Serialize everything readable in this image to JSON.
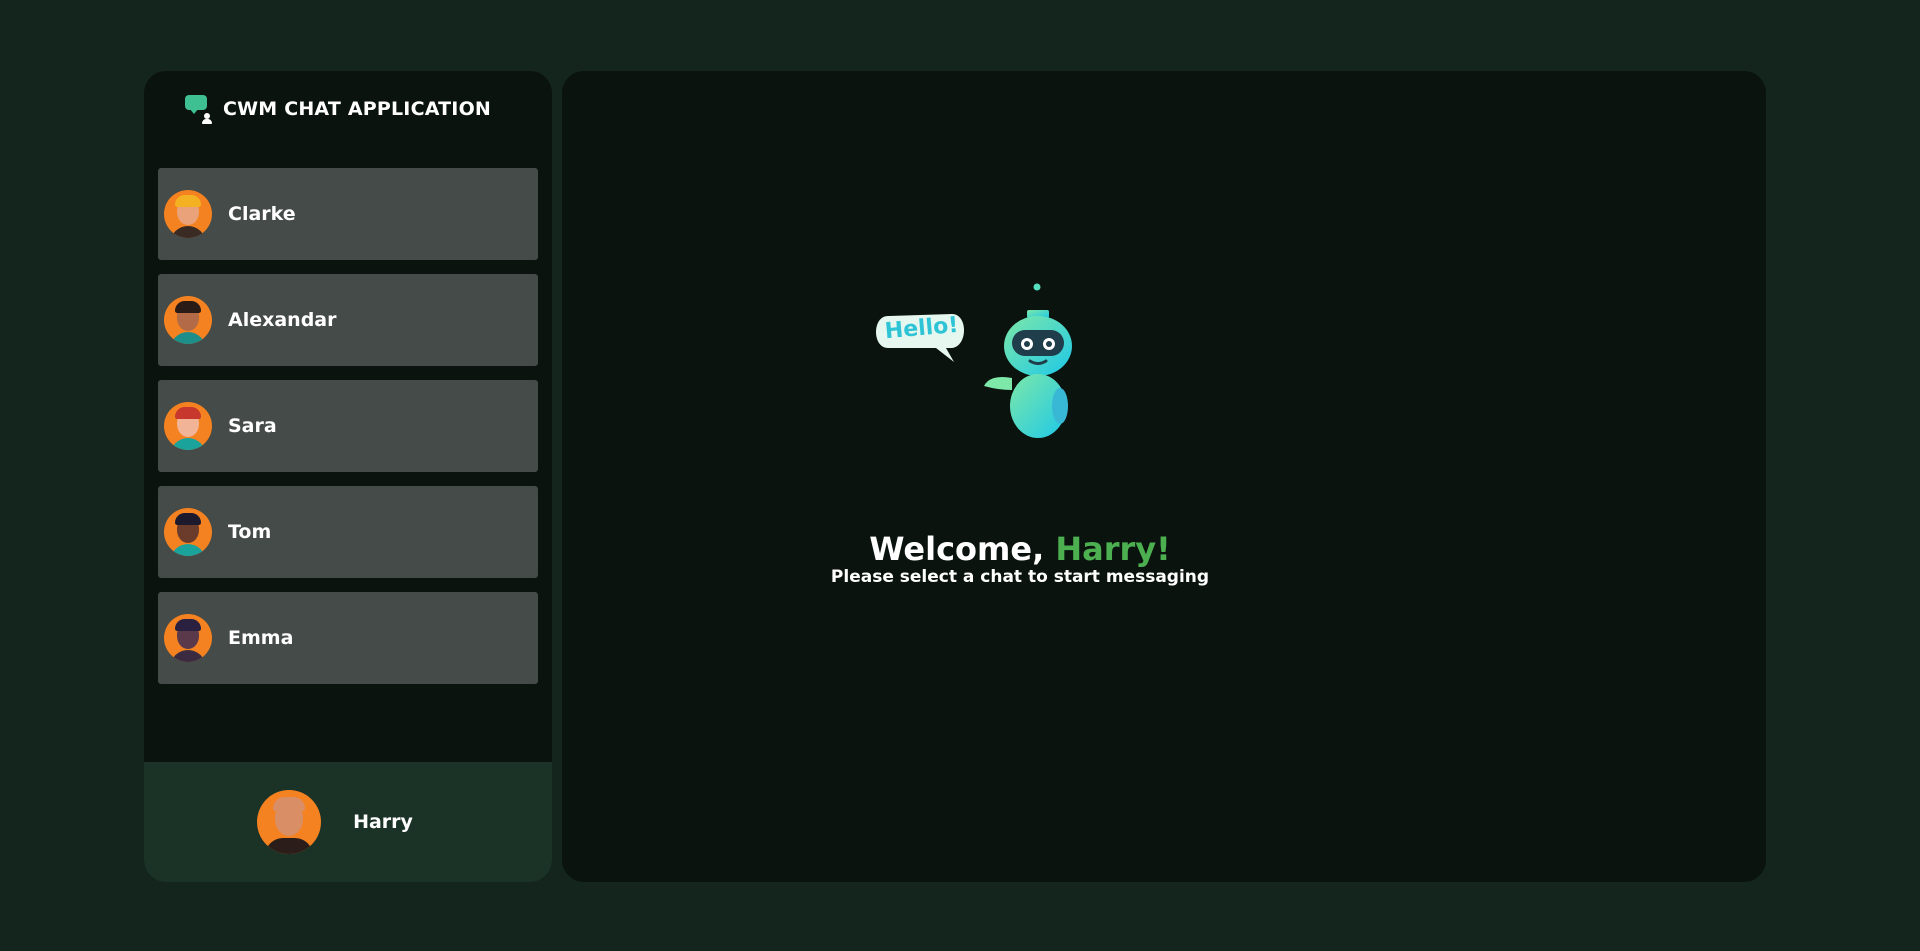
{
  "app": {
    "title": "CWM CHAT APPLICATION"
  },
  "chats": [
    {
      "name": "Clarke",
      "avatar": "man-with-hardhat-avatar",
      "hair": "#f4b223",
      "skin": "#e9a27a",
      "shirt": "#3a2a24"
    },
    {
      "name": "Alexandar",
      "avatar": "bearded-man-avatar",
      "hair": "#2a1b16",
      "skin": "#b36a46",
      "shirt": "#1e8e8a"
    },
    {
      "name": "Sara",
      "avatar": "red-haired-woman-avatar",
      "hair": "#c8372d",
      "skin": "#f2b497",
      "shirt": "#1aa39b"
    },
    {
      "name": "Tom",
      "avatar": "dark-skinned-man-avatar",
      "hair": "#1e1a2e",
      "skin": "#6b3b2b",
      "shirt": "#1aa39b"
    },
    {
      "name": "Emma",
      "avatar": "dark-haired-woman-avatar",
      "hair": "#2a2140",
      "skin": "#5a3a4a",
      "shirt": "#3b2b40"
    }
  ],
  "current_user": {
    "name": "Harry",
    "avatar": "bald-bearded-man-avatar"
  },
  "welcome": {
    "prefix": "Welcome, ",
    "name": "Harry!",
    "subtitle": "Please select a chat to start messaging",
    "robot_bubble": "Hello!"
  },
  "colors": {
    "background": "#13251c",
    "panel": "#0a130e",
    "chat_item": "#454b48",
    "user_bar": "#1b3326",
    "accent": "#4caf50",
    "avatar_bg": "#f58220"
  }
}
